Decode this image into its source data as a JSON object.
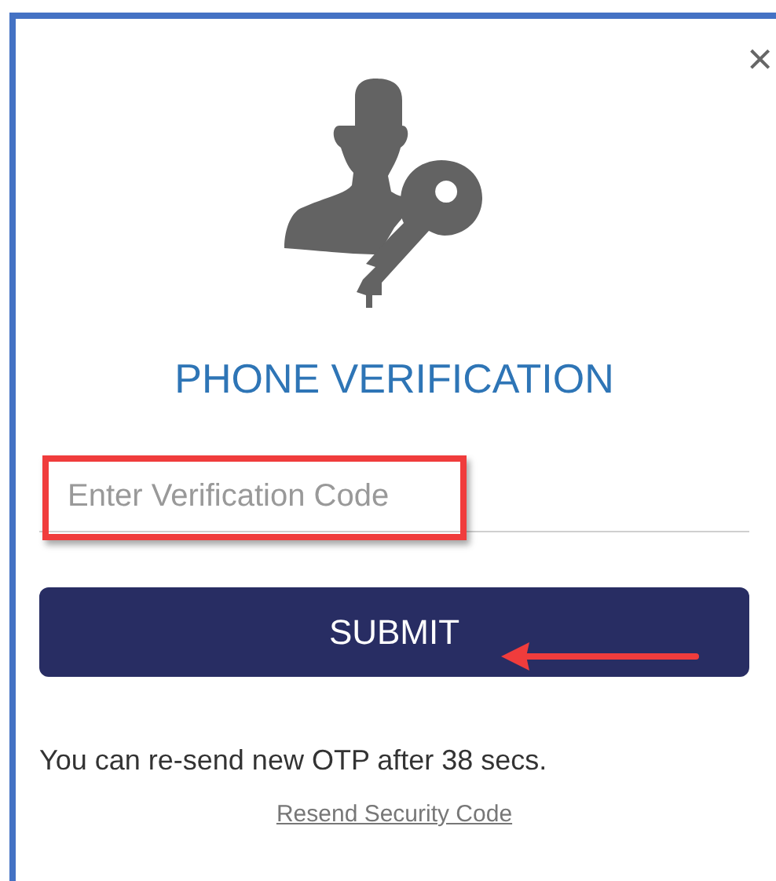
{
  "dialog": {
    "close": "×",
    "title": "PHONE VERIFICATION",
    "code_field": {
      "placeholder": "Enter Verification Code"
    },
    "submit_button": "SUBMIT",
    "countdown_text": "You can re-send new OTP after 38 secs.",
    "resend_link": "Resend Security Code"
  }
}
